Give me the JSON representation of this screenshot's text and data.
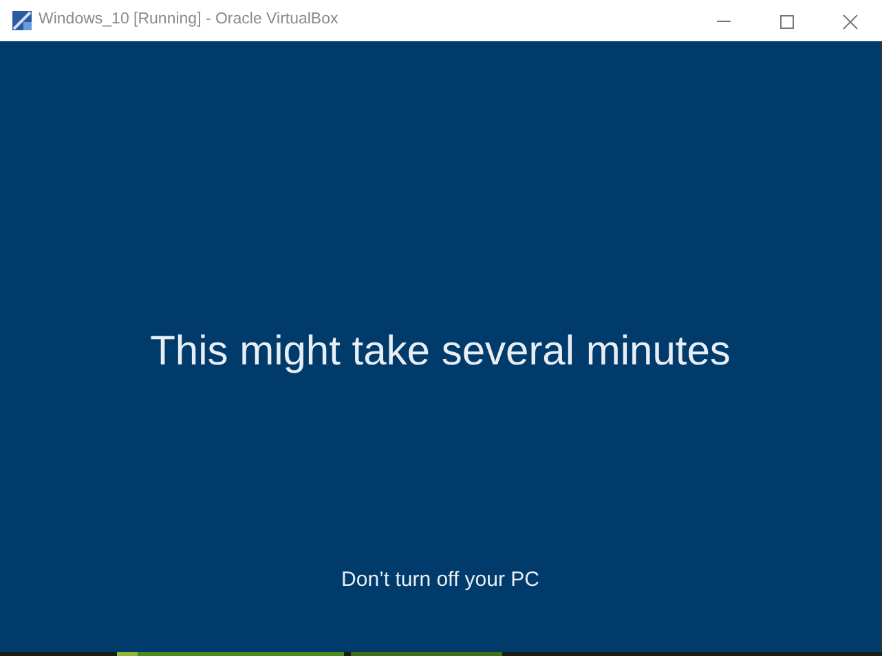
{
  "window": {
    "title": "Windows_10 [Running] - Oracle VirtualBox"
  },
  "screen": {
    "heading": "This might take several minutes",
    "message": "Don’t turn off your PC"
  }
}
